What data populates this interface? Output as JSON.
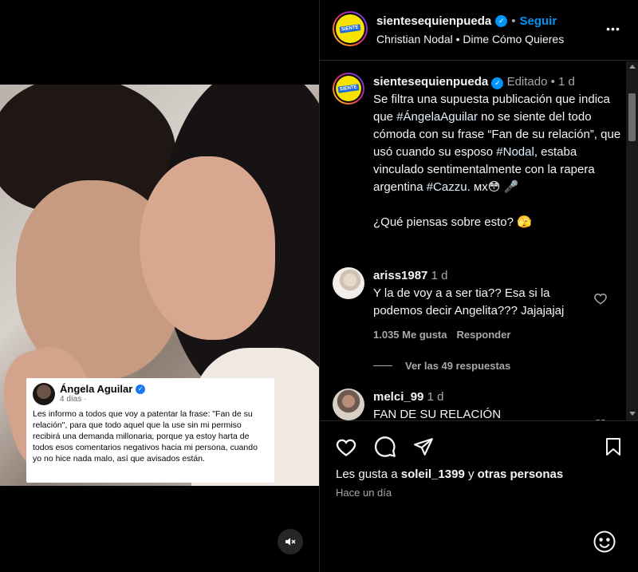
{
  "post": {
    "username": "sientesequienpueda",
    "follow_label": "Seguir",
    "audio": "Christian Nodal • Dime Cómo Quieres",
    "logo_text": "SIENTE",
    "more_label": "•••"
  },
  "media": {
    "quote": {
      "author": "Ángela Aguilar",
      "time": "4 días ·",
      "body": "Les informo a todos que voy a patentar la frase: \"Fan de su relación\", para que todo aquel que la use sin mi permiso recibirá una demanda millonaria, porque ya estoy harta de todos esos comentarios negativos hacia mi persona, cuando yo no hice nada malo, así que avisados están."
    },
    "mute_icon": "speaker-muted-icon"
  },
  "caption": {
    "username": "sientesequienpueda",
    "meta": "Editado • 1 d",
    "text_a": "Se filtra una supuesta publicación que indica que ",
    "tag1": "#ÁngelaAguilar",
    "text_b": " no se siente del todo cómoda con su frase “Fan de su relación”, que usó cuando su esposo ",
    "tag2": "#Nodal",
    "text_c": ", estaba vinculado sentimentalmente con la rapera argentina ",
    "tag3": "#Cazzu",
    "text_d": ". мх😳 🎤",
    "question": "¿Qué piensas sobre esto? 🫣"
  },
  "comments": [
    {
      "username": "ariss1987",
      "time": "1 d",
      "text": "Y la de voy a a ser tia?? Esa si la podemos decir Angelita??? Jajajajaj",
      "likes": "1.035 Me gusta",
      "reply": "Responder",
      "replies": "Ver las 49 respuestas"
    },
    {
      "username": "melci_99",
      "time": "1 d",
      "text": "FAN DE SU RELACIÓN"
    }
  ],
  "footer": {
    "likes_prefix": "Les gusta a ",
    "likes_user": "soleil_1399",
    "likes_mid": " y ",
    "likes_others": "otras personas",
    "time": "Hace un día"
  }
}
